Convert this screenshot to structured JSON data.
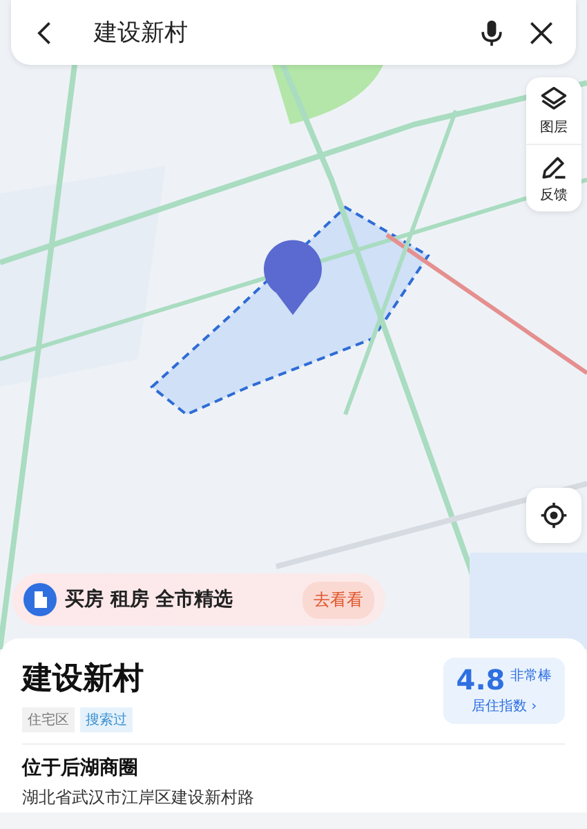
{
  "search": {
    "value": "建设新村"
  },
  "map_tools": [
    {
      "label": "图层",
      "kind": "layers"
    },
    {
      "label": "反馈",
      "kind": "feedback"
    }
  ],
  "banner": {
    "text": "买房 租房 全市精选",
    "action": "去看看"
  },
  "place": {
    "name": "建设新村",
    "tags": [
      {
        "label": "住宅区",
        "kind": "category"
      },
      {
        "label": "搜索过",
        "kind": "history"
      }
    ],
    "score": "4.8",
    "score_rating": "非常棒",
    "score_label": "居住指数 ›",
    "area": "位于后湖商圈",
    "address": "湖北省武汉市江岸区建设新村路"
  }
}
